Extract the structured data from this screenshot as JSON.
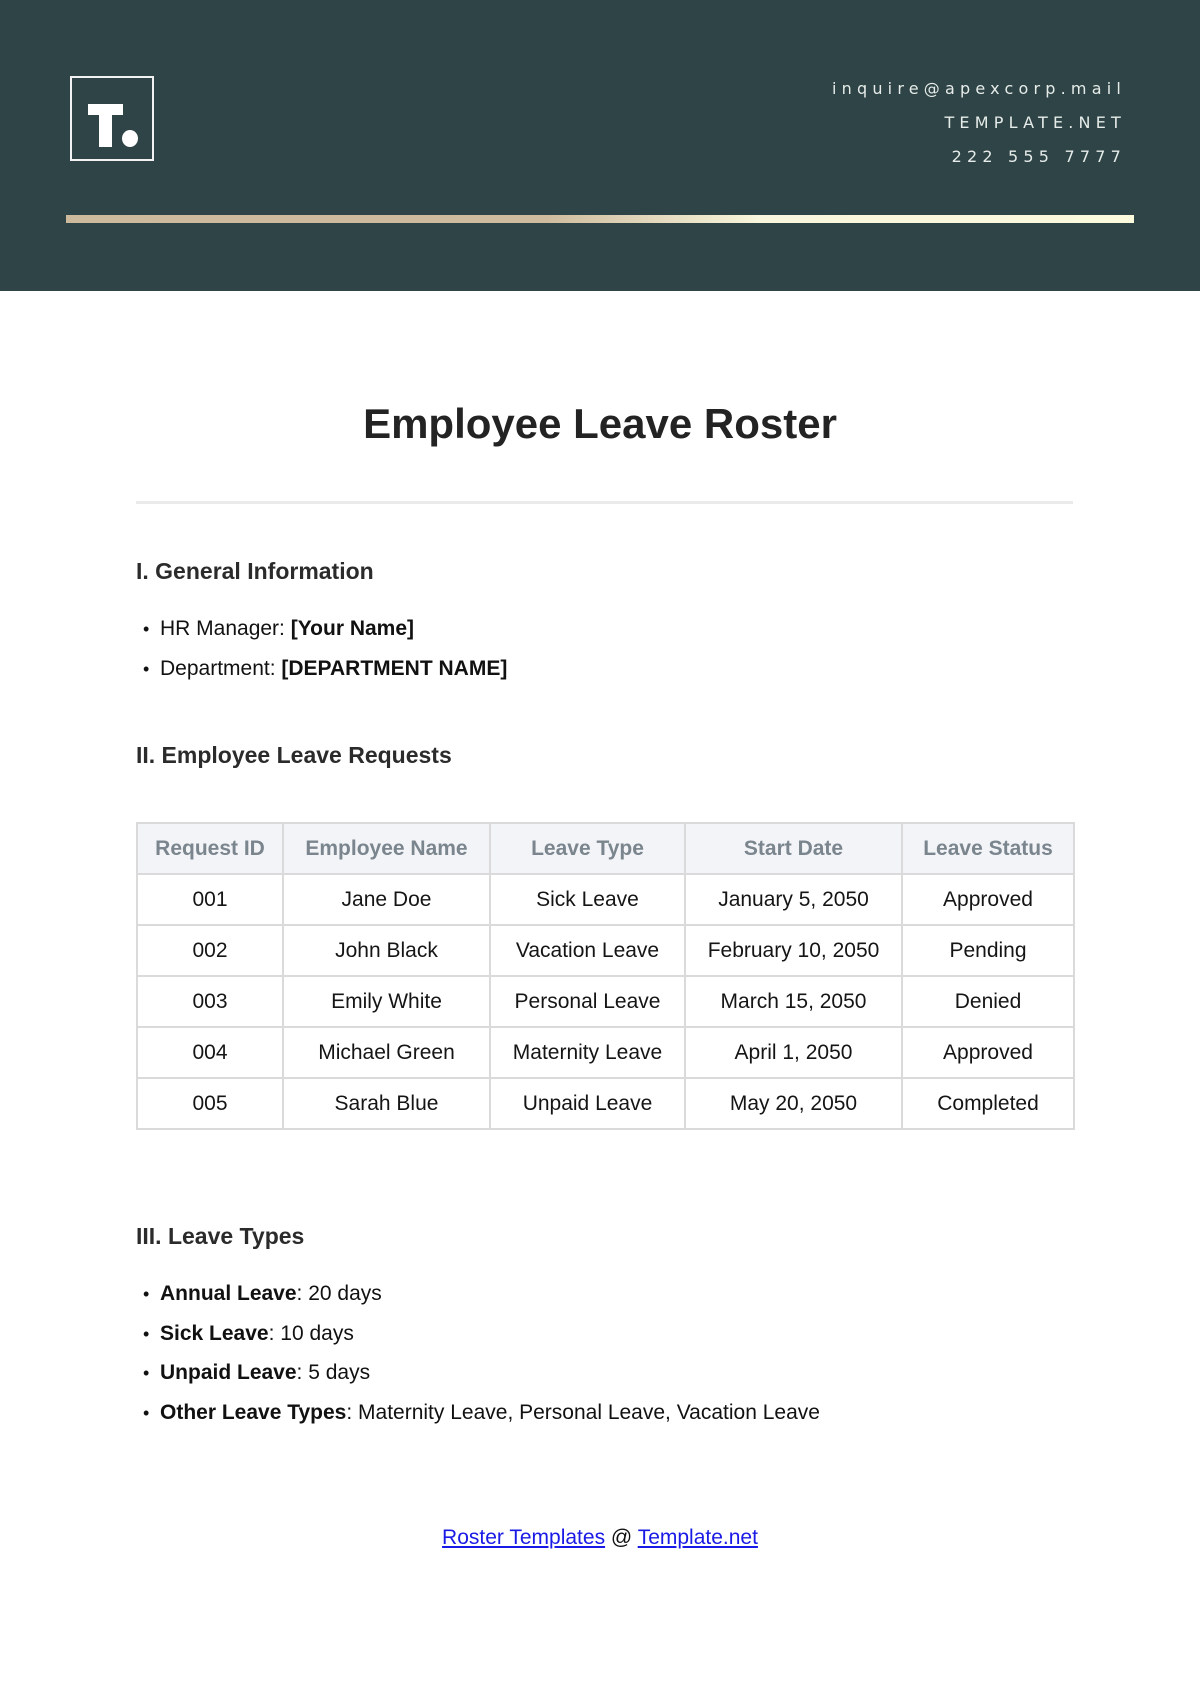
{
  "header": {
    "logo_letter": "T",
    "contact": {
      "email": "inquire@apexcorp.mail",
      "website": "TEMPLATE.NET",
      "phone": "222 555 7777"
    },
    "colors": {
      "background": "#2f4446",
      "accent_line_start": "#cdb99c",
      "accent_line_end": "#fbfadd"
    }
  },
  "document": {
    "title": "Employee Leave Roster",
    "sections": {
      "general": {
        "heading": "I. General Information",
        "items": [
          {
            "label": "HR Manager: ",
            "value": "[Your Name]"
          },
          {
            "label": "Department: ",
            "value": "[DEPARTMENT NAME]"
          }
        ]
      },
      "requests": {
        "heading": "II. Employee Leave Requests",
        "table": {
          "columns": [
            "Request ID",
            "Employee Name",
            "Leave Type",
            "Start Date",
            "Leave Status"
          ],
          "rows": [
            [
              "001",
              "Jane Doe",
              "Sick Leave",
              "January 5, 2050",
              "Approved"
            ],
            [
              "002",
              "John Black",
              "Vacation Leave",
              "February 10, 2050",
              "Pending"
            ],
            [
              "003",
              "Emily White",
              "Personal Leave",
              "March 15, 2050",
              "Denied"
            ],
            [
              "004",
              "Michael Green",
              "Maternity Leave",
              "April 1, 2050",
              "Approved"
            ],
            [
              "005",
              "Sarah Blue",
              "Unpaid Leave",
              "May 20, 2050",
              "Completed"
            ]
          ]
        }
      },
      "types": {
        "heading": "III. Leave Types",
        "items": [
          {
            "label": "Annual Leave",
            "value": ": 20 days"
          },
          {
            "label": "Sick Leave",
            "value": ": 10 days"
          },
          {
            "label": "Unpaid Leave",
            "value": ": 5 days"
          },
          {
            "label": "Other Leave Types",
            "value": ": Maternity Leave, Personal Leave, Vacation Leave"
          }
        ]
      }
    }
  },
  "footer": {
    "link1": "Roster Templates",
    "separator": " @ ",
    "link2": "Template.net",
    "link_color": "#1a1ae6"
  }
}
